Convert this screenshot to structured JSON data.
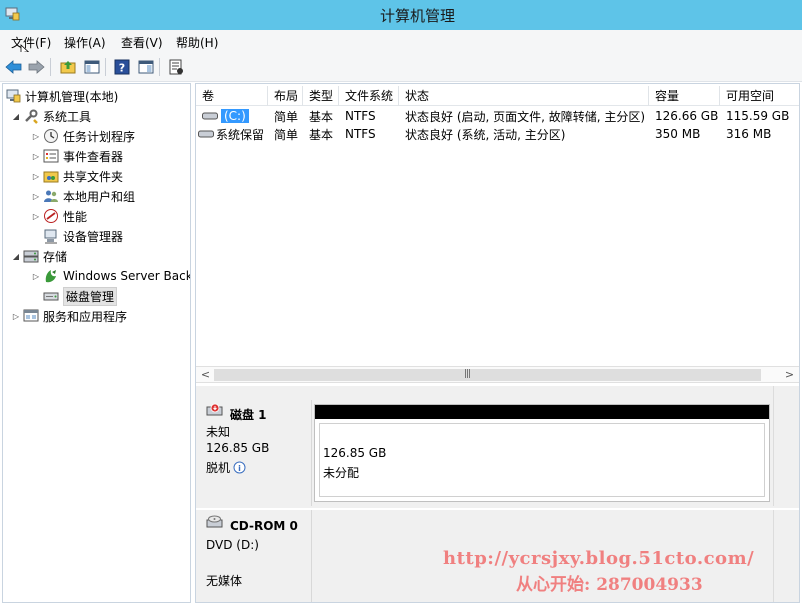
{
  "window": {
    "title": "计算机管理"
  },
  "menu": [
    {
      "label": "文件(F)"
    },
    {
      "label": "操作(A)"
    },
    {
      "label": "查看(V)"
    },
    {
      "label": "帮助(H)"
    }
  ],
  "toolbar": {
    "icons": [
      "back-arrow-icon",
      "forward-arrow-icon",
      "up-folder-icon",
      "show-hide-tree-icon",
      "help-icon",
      "properties-icon",
      "export-icon"
    ]
  },
  "tree": {
    "root": "计算机管理(本地)",
    "system_tools": "系统工具",
    "task_scheduler": "任务计划程序",
    "event_viewer": "事件查看器",
    "shared_folders": "共享文件夹",
    "local_users": "本地用户和组",
    "performance": "性能",
    "device_manager": "设备管理器",
    "storage": "存储",
    "windows_backup": "Windows Server Back",
    "disk_management": "磁盘管理",
    "services_apps": "服务和应用程序"
  },
  "volumes": {
    "columns": [
      "卷",
      "布局",
      "类型",
      "文件系统",
      "状态",
      "容量",
      "可用空间"
    ],
    "rows": [
      {
        "name": "(C:)",
        "layout": "简单",
        "type": "基本",
        "fs": "NTFS",
        "status": "状态良好 (启动, 页面文件, 故障转储, 主分区)",
        "capacity": "126.66 GB",
        "free": "115.59 GB"
      },
      {
        "name": "系统保留",
        "layout": "简单",
        "type": "基本",
        "fs": "NTFS",
        "status": "状态良好 (系统, 活动, 主分区)",
        "capacity": "350 MB",
        "free": "316 MB"
      }
    ]
  },
  "disks": [
    {
      "name": "磁盘 1",
      "kind": "未知",
      "size": "126.85 GB",
      "state": "脱机",
      "part_size": "126.85 GB",
      "part_status": "未分配"
    },
    {
      "name": "CD-ROM 0",
      "kind": "DVD (D:)",
      "state": "无媒体"
    }
  ],
  "watermark": {
    "url": "http://ycrsjxy.blog.51cto.com/",
    "text": "从心开始: 287004933"
  }
}
